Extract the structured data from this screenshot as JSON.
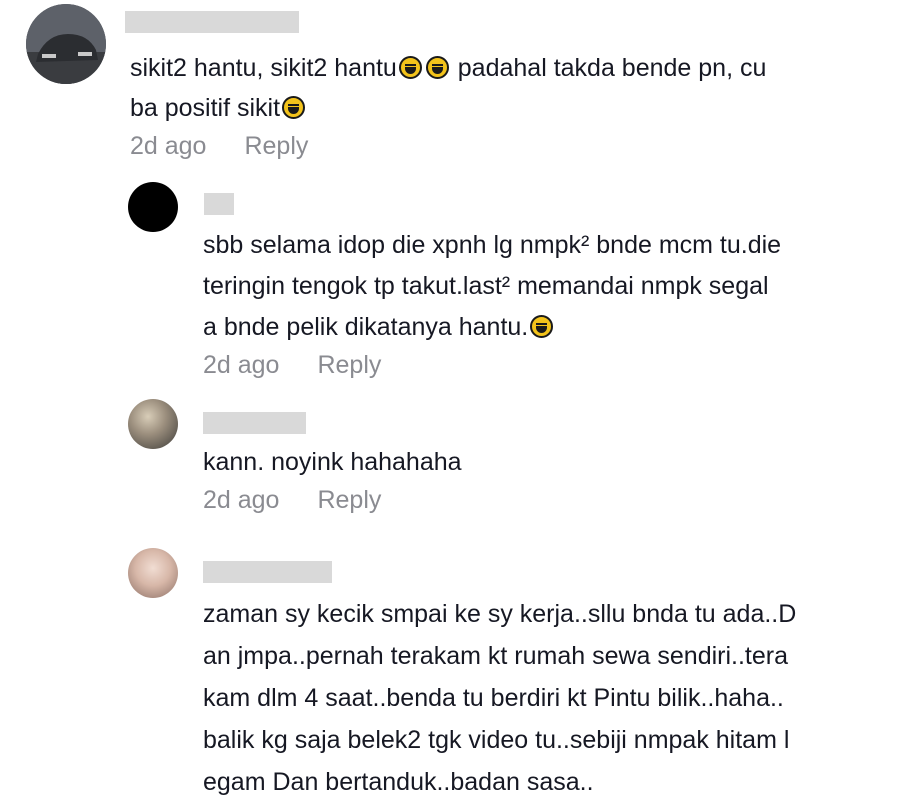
{
  "comments": [
    {
      "avatar": "car-photo-avatar",
      "lines": [
        "sikit2 hantu, sikit2 hantu",
        "ba positif sikit"
      ],
      "line1_mid": "padahal takda bende pn, cu",
      "time": "2d ago",
      "reply": "Reply"
    },
    {
      "avatar": "black-avatar",
      "lines": [
        "sbb selama idop die xpnh lg nmpk² bnde mcm tu.die",
        "teringin tengok tp takut.last² memandai nmpk segal",
        "a bnde pelik dikatanya hantu."
      ],
      "time": "2d ago",
      "reply": "Reply"
    },
    {
      "avatar": "sunset-avatar",
      "lines": [
        "kann. noyink hahahaha"
      ],
      "time": "2d ago",
      "reply": "Reply"
    },
    {
      "avatar": "girl-avatar",
      "lines": [
        "zaman sy kecik smpai ke sy kerja..sllu bnda tu ada..D",
        "an jmpa..pernah terakam kt rumah sewa sendiri..tera",
        "kam dlm 4 saat..benda tu berdiri kt Pintu bilik..haha..",
        "balik kg saja belek2 tgk video tu..sebiji nmpak hitam l",
        "egam Dan bertanduk..badan sasa.."
      ]
    }
  ],
  "emoji": "grinning-sweat-emoji"
}
